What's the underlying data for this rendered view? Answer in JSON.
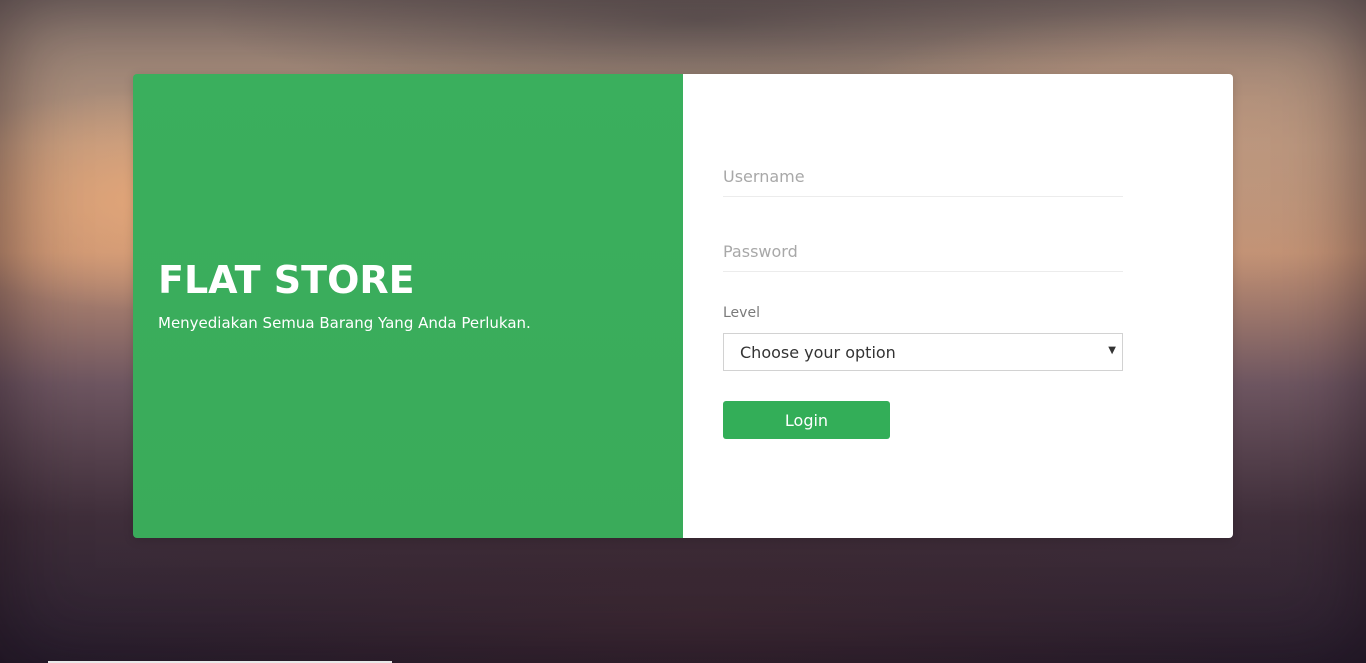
{
  "brand": {
    "title": "FLAT STORE",
    "subtitle": "Menyediakan Semua Barang Yang Anda Perlukan."
  },
  "form": {
    "username": {
      "placeholder": "Username",
      "value": ""
    },
    "password": {
      "placeholder": "Password",
      "value": ""
    },
    "level": {
      "label": "Level",
      "selected": "Choose your option"
    },
    "login_label": "Login"
  },
  "colors": {
    "brand_green": "#3aaf5d",
    "button_green": "#33ae58",
    "panel_white": "#ffffff"
  },
  "icons": {
    "select_arrow": "chevron-down-icon"
  }
}
